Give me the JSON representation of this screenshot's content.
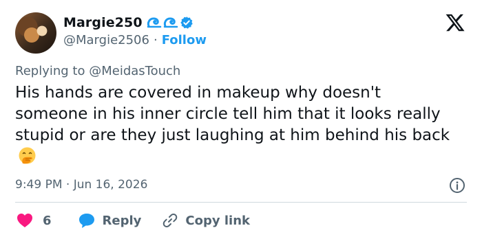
{
  "author": {
    "display_name": "Margie250",
    "handle": "@Margie2506",
    "separator": "·",
    "follow_label": "Follow",
    "badges": [
      "wave-icon",
      "wave-icon",
      "verified-badge-icon"
    ]
  },
  "reply_context": {
    "prefix": "Replying to",
    "mention": "@MeidasTouch"
  },
  "tweet": {
    "text": "His hands are covered in makeup why doesn't someone in his inner circle tell him that it looks really stupid or are they just laughing at him behind his back",
    "emoji": "face-with-hand-over-mouth-icon",
    "timestamp": "9:49 PM · Jun 16, 2026"
  },
  "actions": {
    "like_count": "6",
    "reply_label": "Reply",
    "copy_link_label": "Copy link"
  },
  "colors": {
    "accent": "#1d9bf0",
    "like": "#f91880",
    "secondary_text": "#536471",
    "divider": "#cfd9de"
  }
}
